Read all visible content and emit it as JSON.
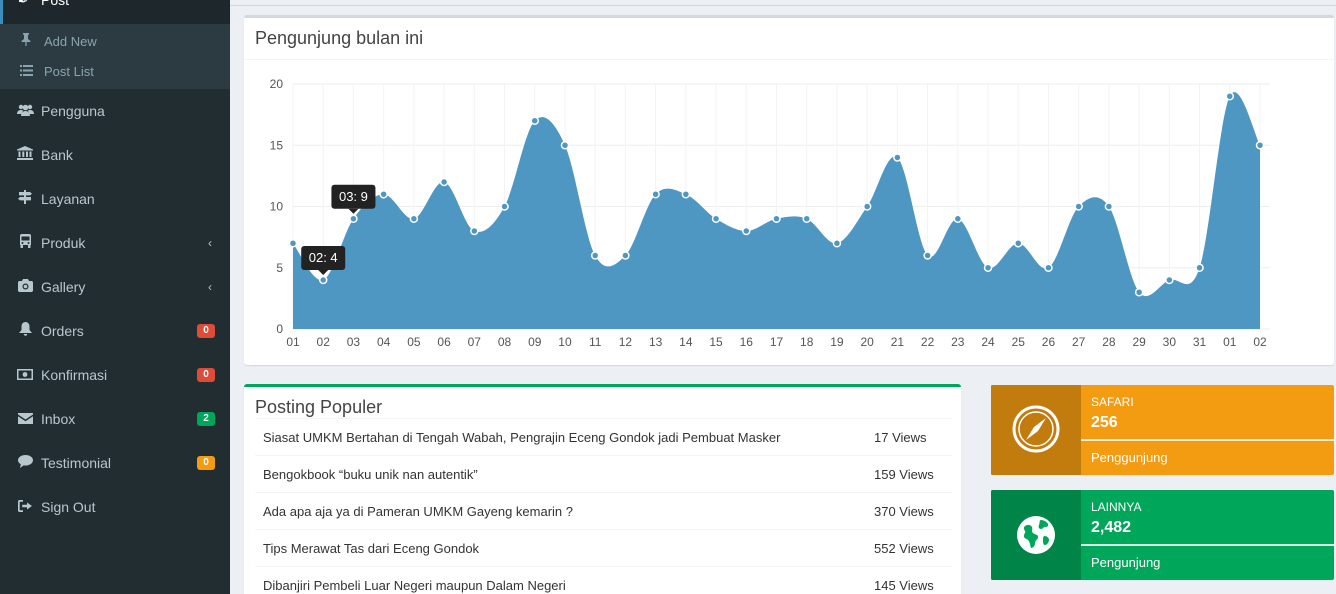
{
  "sidebar": {
    "top_label": "Post",
    "sub_items": [
      {
        "label": "Add New",
        "icon": "pin-icon"
      },
      {
        "label": "Post List",
        "icon": "list-icon"
      }
    ],
    "items": [
      {
        "label": "Pengguna",
        "icon": "users-icon"
      },
      {
        "label": "Bank",
        "icon": "bank-icon"
      },
      {
        "label": "Layanan",
        "icon": "signpost-icon"
      },
      {
        "label": "Produk",
        "icon": "bus-icon",
        "chevron": true
      },
      {
        "label": "Gallery",
        "icon": "camera-icon",
        "chevron": true
      },
      {
        "label": "Orders",
        "icon": "bell-icon",
        "badge": "0",
        "badge_color": "#dd4b39"
      },
      {
        "label": "Konfirmasi",
        "icon": "money-icon",
        "badge": "0",
        "badge_color": "#dd4b39"
      },
      {
        "label": "Inbox",
        "icon": "envelope-icon",
        "badge": "2",
        "badge_color": "#00a65a"
      },
      {
        "label": "Testimonial",
        "icon": "comment-icon",
        "badge": "0",
        "badge_color": "#f39c12"
      },
      {
        "label": "Sign Out",
        "icon": "sign-out-icon"
      }
    ]
  },
  "visitors": {
    "title": "Pengunjung bulan ini"
  },
  "chart_data": {
    "type": "area",
    "title": "Pengunjung bulan ini",
    "x": [
      "01",
      "02",
      "03",
      "04",
      "05",
      "06",
      "07",
      "08",
      "09",
      "10",
      "11",
      "12",
      "13",
      "14",
      "15",
      "16",
      "17",
      "18",
      "19",
      "20",
      "21",
      "22",
      "23",
      "24",
      "25",
      "26",
      "27",
      "28",
      "29",
      "30",
      "31",
      "01",
      "02"
    ],
    "values": [
      7,
      4,
      9,
      11,
      9,
      12,
      8,
      10,
      17,
      15,
      6,
      6,
      11,
      11,
      9,
      8,
      9,
      9,
      7,
      10,
      14,
      6,
      9,
      5,
      7,
      5,
      10,
      10,
      3,
      4,
      5,
      19,
      15
    ],
    "ylim": [
      0,
      20
    ],
    "yticks": [
      0,
      5,
      10,
      15,
      20
    ],
    "grid": true,
    "color": "#4e97c3",
    "tooltips": [
      "02: 4",
      "03: 9"
    ]
  },
  "popular": {
    "title": "Posting Populer",
    "rows": [
      {
        "title": "Siasat UMKM Bertahan di Tengah Wabah, Pengrajin Eceng Gondok jadi Pembuat Masker",
        "views": "17 Views"
      },
      {
        "title": "Bengokbook “buku unik nan autentik”",
        "views": "159 Views"
      },
      {
        "title": "Ada apa aja ya di Pameran UMKM Gayeng kemarin ?",
        "views": "370 Views"
      },
      {
        "title": "Tips Merawat Tas dari Eceng Gondok",
        "views": "552 Views"
      },
      {
        "title": "Dibanjiri Pembeli Luar Negeri maupun Dalam Negeri",
        "views": "145 Views"
      }
    ]
  },
  "info_boxes": {
    "safari": {
      "label": "SAFARI",
      "number": "256",
      "desc": "Penggunjung",
      "icon": "compass-icon",
      "color": "#f39c12"
    },
    "lainnya": {
      "label": "LAINNYA",
      "number": "2,482",
      "desc": "Pengunjung",
      "icon": "globe-icon",
      "color": "#00a65a"
    }
  }
}
